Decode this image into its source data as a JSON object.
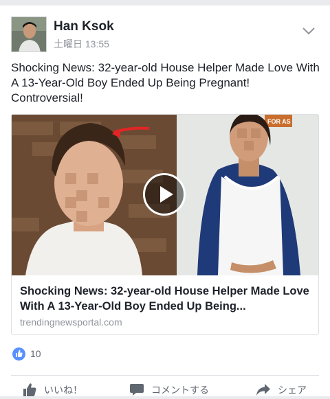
{
  "post": {
    "author": "Han Ksok",
    "timestamp": "土曜日 13:55",
    "text": "Shocking News: 32-year-old House Helper Made Love With A 13-Year-Old Boy Ended Up Being Pregnant! Controversial!"
  },
  "link_preview": {
    "title": "Shocking News: 32-year-old House Helper Made Love With A 13-Year-Old Boy Ended Up Being...",
    "domain": "trendingnewsportal.com",
    "image_sign_text": "FOR AS"
  },
  "reactions": {
    "like_count": "10"
  },
  "actions": {
    "like": "いいね！",
    "comment": "コメントする",
    "share": "シェア"
  },
  "colors": {
    "accent": "#5890ff",
    "background": "#e9ebee",
    "secondary_text": "#90949c"
  },
  "icons": {
    "menu": "chevron-down-icon",
    "play": "play-icon",
    "like": "thumbs-up-icon",
    "comment": "comment-icon",
    "share": "share-arrow-icon"
  }
}
